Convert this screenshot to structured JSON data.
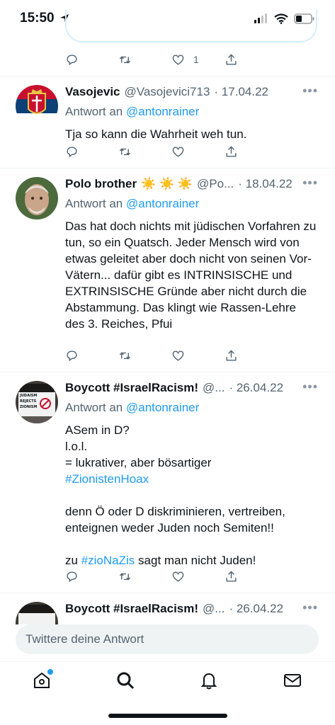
{
  "status": {
    "time": "15:50"
  },
  "tweets": [
    {
      "name": "Vasojevic",
      "handle": "@Vasojevici713",
      "date": "· 17.04.22",
      "reply_prefix": "Antwort an",
      "reply_to": "@antonrainer",
      "text": "Tja so kann die Wahrheit weh tun.",
      "avatar_icon": "serbian-crest-avatar"
    },
    {
      "name": "Polo brother",
      "emoji": "☀️ ☀️ ☀️",
      "handle": "@Po...",
      "date": "· 18.04.22",
      "reply_prefix": "Antwort an",
      "reply_to": "@antonrainer",
      "text": "Das hat doch nichts mit jüdischen Vorfahren zu tun, so ein Quatsch. Jeder Mensch wird von etwas geleitet aber doch nicht von seinen Vor-Vätern... dafür gibt es INTRINSISCHE und EXTRINSISCHE Gründe aber nicht durch die Abstammung. Das klingt wie Rassen-Lehre des 3. Reiches, Pfui",
      "avatar_icon": "man-portrait-avatar"
    },
    {
      "name": "Boycott #IsraelRacism!",
      "handle": "@...",
      "date": "· 26.04.22",
      "reply_prefix": "Antwort an",
      "reply_to": "@antonrainer",
      "text_part1": "ASem in D?\nl.o.l.\n= lukrativer, aber bösartiger",
      "hashtag1": "#ZionistenHoax",
      "text_part2": "denn Ö oder D diskriminieren, vertreiben, enteignen weder Juden noch Semiten!!",
      "text_part3_prefix": "zu",
      "hashtag2": "#zioNaZis",
      "text_part3_suffix": "sagt man nicht Juden!",
      "avatar_sign_text": "JUDAISM REJECTS ZIONISM"
    },
    {
      "name": "Boycott #IsraelRacism!",
      "handle": "@...",
      "date": "· 26.04.22"
    }
  ],
  "first_tweet_like_count": "1",
  "reply_placeholder": "Twittere deine Antwort",
  "tabbar": {
    "items": [
      "home-icon",
      "search-icon",
      "bell-icon",
      "mail-icon"
    ]
  },
  "colors": {
    "accent": "#1d9bf0",
    "muted": "#536471",
    "text": "#0f1419"
  }
}
